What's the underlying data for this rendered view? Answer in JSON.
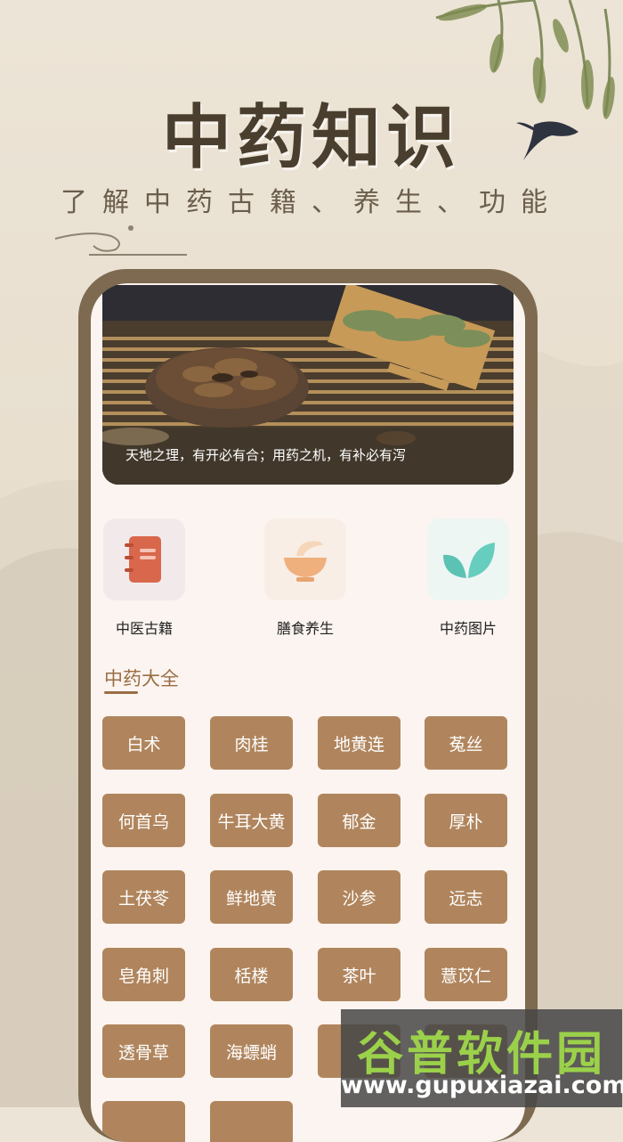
{
  "hero": {
    "title": "中药知识",
    "subtitle": "了解中药古籍、养生、功能"
  },
  "banner": {
    "caption": "天地之理，有开必有合；用药之机，有补必有泻"
  },
  "quick_links": [
    {
      "label": "中医古籍",
      "icon": "book-icon"
    },
    {
      "label": "膳食养生",
      "icon": "bowl-icon"
    },
    {
      "label": "中药图片",
      "icon": "leaf-icon"
    }
  ],
  "section": {
    "title": "中药大全"
  },
  "herbs": [
    "白术",
    "肉桂",
    "地黄连",
    "菟丝",
    "何首乌",
    "牛耳大黄",
    "郁金",
    "厚朴",
    "土茯苓",
    "鲜地黄",
    "沙参",
    "远志",
    "皂角刺",
    "栝楼",
    "茶叶",
    "薏苡仁",
    "透骨草",
    "海螵蛸",
    "",
    ""
  ],
  "watermark": {
    "name": "谷普软件园",
    "url": "www.gupuxiazai.com"
  },
  "colors": {
    "accent": "#b0855d",
    "title": "#9a6d44",
    "phone_frame": "#7d6a50"
  }
}
